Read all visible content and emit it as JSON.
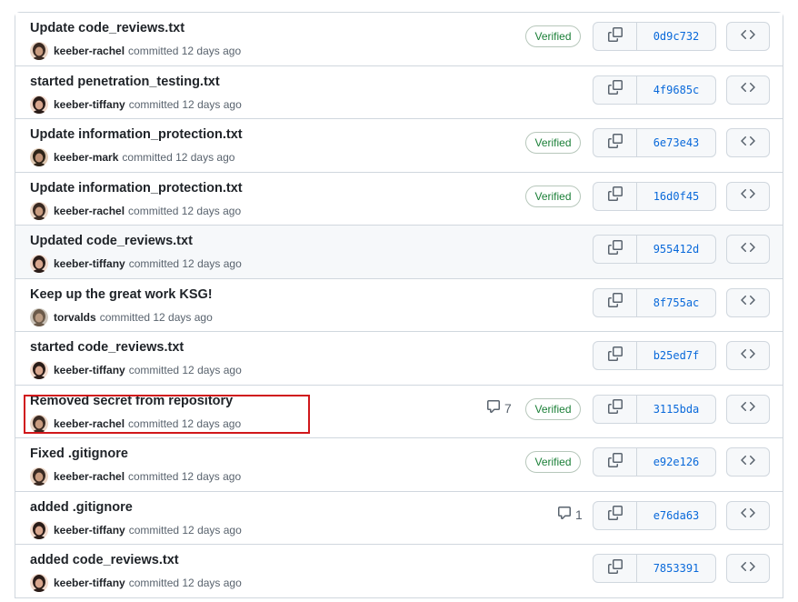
{
  "commits": [
    {
      "message": "Update code_reviews.txt",
      "author": "keeber-rachel",
      "time": "committed 12 days ago",
      "sha": "0d9c732",
      "verified": "Verified",
      "comments": ""
    },
    {
      "message": "started penetration_testing.txt",
      "author": "keeber-tiffany",
      "time": "committed 12 days ago",
      "sha": "4f9685c",
      "verified": "",
      "comments": ""
    },
    {
      "message": "Update information_protection.txt",
      "author": "keeber-mark",
      "time": "committed 12 days ago",
      "sha": "6e73e43",
      "verified": "Verified",
      "comments": ""
    },
    {
      "message": "Update information_protection.txt",
      "author": "keeber-rachel",
      "time": "committed 12 days ago",
      "sha": "16d0f45",
      "verified": "Verified",
      "comments": ""
    },
    {
      "message": "Updated code_reviews.txt",
      "author": "keeber-tiffany",
      "time": "committed 12 days ago",
      "sha": "955412d",
      "verified": "",
      "comments": ""
    },
    {
      "message": "Keep up the great work KSG!",
      "author": "torvalds",
      "time": "committed 12 days ago",
      "sha": "8f755ac",
      "verified": "",
      "comments": ""
    },
    {
      "message": "started code_reviews.txt",
      "author": "keeber-tiffany",
      "time": "committed 12 days ago",
      "sha": "b25ed7f",
      "verified": "",
      "comments": ""
    },
    {
      "message": "Removed secret from repository",
      "author": "keeber-rachel",
      "time": "committed 12 days ago",
      "sha": "3115bda",
      "verified": "Verified",
      "comments": "7"
    },
    {
      "message": "Fixed .gitignore",
      "author": "keeber-rachel",
      "time": "committed 12 days ago",
      "sha": "e92e126",
      "verified": "Verified",
      "comments": ""
    },
    {
      "message": "added .gitignore",
      "author": "keeber-tiffany",
      "time": "committed 12 days ago",
      "sha": "e76da63",
      "verified": "",
      "comments": "1"
    },
    {
      "message": "added code_reviews.txt",
      "author": "keeber-tiffany",
      "time": "committed 12 days ago",
      "sha": "7853391",
      "verified": "",
      "comments": ""
    }
  ],
  "icons": {
    "copy": "copy-icon",
    "browse": "code-icon",
    "comment": "comment-icon"
  },
  "colors": {
    "verified": "#1a7f37",
    "sha": "#0969da",
    "highlight": "#d0171b"
  }
}
